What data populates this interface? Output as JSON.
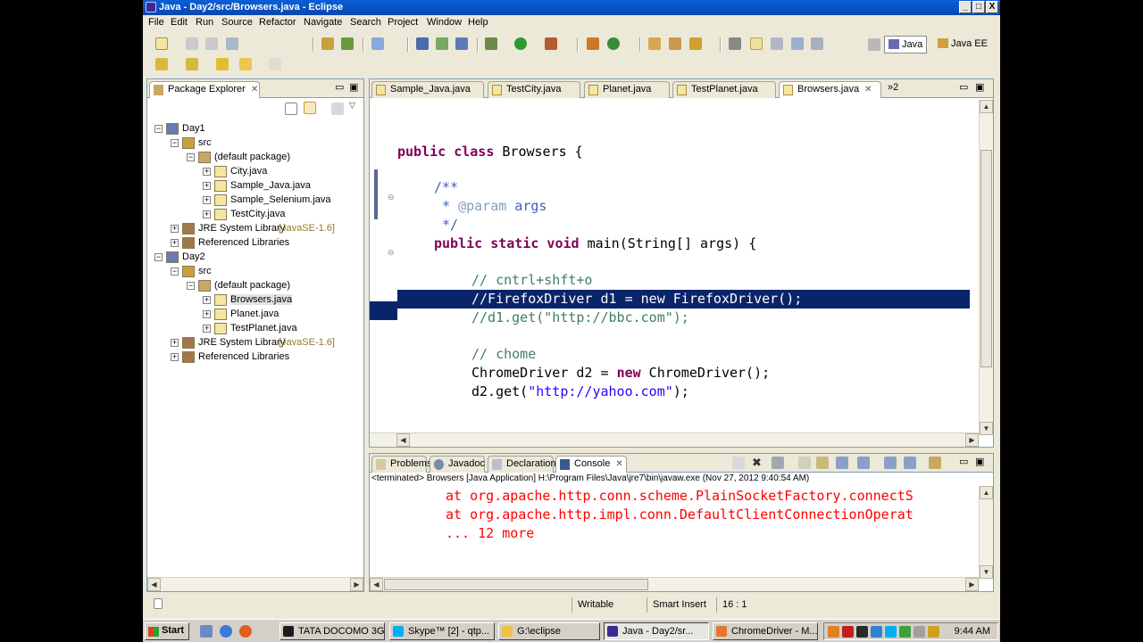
{
  "window": {
    "title": "Java - Day2/src/Browsers.java - Eclipse",
    "min": "_",
    "max": "□",
    "close": "X"
  },
  "menu": [
    "File",
    "Edit",
    "Run",
    "Source",
    "Refactor",
    "Navigate",
    "Search",
    "Project",
    "Window",
    "Help"
  ],
  "perspectives": {
    "java": "Java",
    "java_ee": "Java EE"
  },
  "package_explorer": {
    "tab": "Package Explorer",
    "nodes": [
      {
        "label": "Day1",
        "level": 0,
        "expander": "−",
        "icon": "project-icon"
      },
      {
        "label": "src",
        "level": 1,
        "expander": "−",
        "icon": "source-folder-icon"
      },
      {
        "label": "(default package)",
        "level": 2,
        "expander": "−",
        "icon": "package-icon"
      },
      {
        "label": "City.java",
        "level": 3,
        "expander": "+",
        "icon": "java-file-icon"
      },
      {
        "label": "Sample_Java.java",
        "level": 3,
        "expander": "+",
        "icon": "java-file-icon"
      },
      {
        "label": "Sample_Selenium.java",
        "level": 3,
        "expander": "+",
        "icon": "java-file-icon"
      },
      {
        "label": "TestCity.java",
        "level": 3,
        "expander": "+",
        "icon": "java-file-icon"
      },
      {
        "label": "JRE System Library",
        "suffix": "[JavaSE-1.6]",
        "level": 1,
        "expander": "+",
        "icon": "library-icon"
      },
      {
        "label": "Referenced Libraries",
        "level": 1,
        "expander": "+",
        "icon": "library-icon"
      },
      {
        "label": "Day2",
        "level": 0,
        "expander": "−",
        "icon": "project-icon"
      },
      {
        "label": "src",
        "level": 1,
        "expander": "−",
        "icon": "source-folder-icon"
      },
      {
        "label": "(default package)",
        "level": 2,
        "expander": "−",
        "icon": "package-icon"
      },
      {
        "label": "Browsers.java",
        "level": 3,
        "expander": "+",
        "icon": "java-file-icon",
        "selected": true
      },
      {
        "label": "Planet.java",
        "level": 3,
        "expander": "+",
        "icon": "java-file-icon"
      },
      {
        "label": "TestPlanet.java",
        "level": 3,
        "expander": "+",
        "icon": "java-file-icon"
      },
      {
        "label": "JRE System Library",
        "suffix": "[JavaSE-1.6]",
        "level": 1,
        "expander": "+",
        "icon": "library-icon"
      },
      {
        "label": "Referenced Libraries",
        "level": 1,
        "expander": "+",
        "icon": "library-icon"
      }
    ]
  },
  "editor": {
    "tabs": [
      {
        "label": "Sample_Java.java"
      },
      {
        "label": "TestCity.java"
      },
      {
        "label": "Planet.java"
      },
      {
        "label": "TestPlanet.java"
      },
      {
        "label": "Browsers.java",
        "active": true
      }
    ],
    "overflow_tab": "»2",
    "code": {
      "class_kw": "public class",
      "class_name": " Browsers {",
      "jd_open": "/**",
      "jd_star": " * ",
      "jd_tag": "@param",
      "jd_arg": " args",
      "jd_close": " */",
      "main_kw": "public static void",
      "main_sig": " main(String[] args) {",
      "c1": "// cntrl+shft+o",
      "c2": "//FirefoxDriver d1 = new FirefoxDriver();",
      "c3": "//d1.get(\"http://bbc.com\");",
      "c4": "// chome",
      "l5a": "ChromeDriver d2 = ",
      "l5kw": "new",
      "l5b": " ChromeDriver();",
      "l6a": "d2.get(",
      "l6str": "\"http://yahoo.com\"",
      "l6b": ");"
    }
  },
  "bottom_panel": {
    "tabs": [
      "Problems",
      "Javadoc",
      "Declaration",
      "Console"
    ],
    "active_tab": "Console",
    "info": "<terminated> Browsers [Java Application] H:\\Program Files\\Java\\jre7\\bin\\javaw.exe (Nov 27, 2012 9:40:54 AM)",
    "lines": [
      "at org.apache.http.conn.scheme.PlainSocketFactory.connectS",
      "at org.apache.http.impl.conn.DefaultClientConnectionOperat",
      "... 12 more"
    ]
  },
  "status": {
    "writable": "Writable",
    "insert": "Smart Insert",
    "position": "16 : 1"
  },
  "taskbar": {
    "start": "Start",
    "tasks": [
      {
        "label": "TATA DOCOMO 3G",
        "color": "#1c1c1c"
      },
      {
        "label": "Skype™ [2] - qtp...",
        "color": "#00aff0"
      },
      {
        "label": "G:\\eclipse",
        "color": "#f0c040"
      },
      {
        "label": "Java - Day2/sr...",
        "color": "#3b2b8f",
        "active": true
      },
      {
        "label": "ChromeDriver - M...",
        "color": "#e8762d"
      }
    ],
    "clock": "9:44 AM"
  }
}
